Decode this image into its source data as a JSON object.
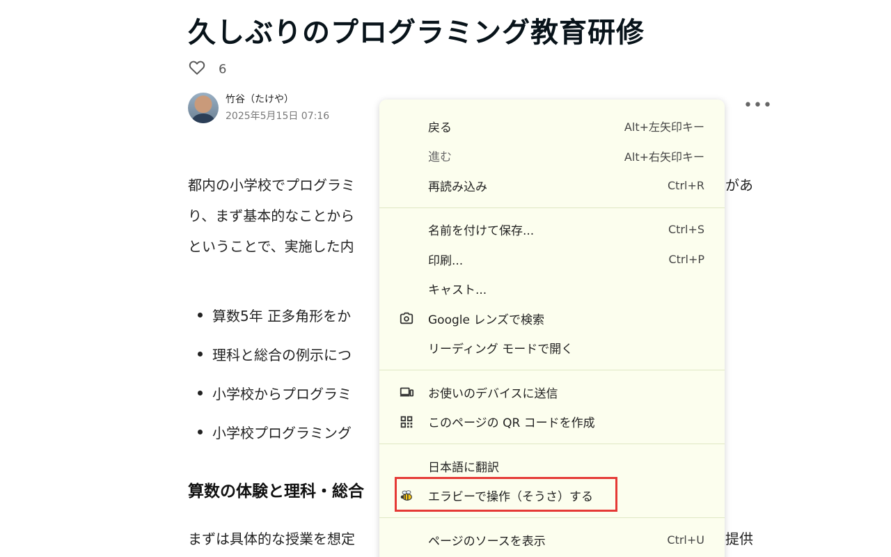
{
  "article": {
    "title": "久しぶりのプログラミング教育研修",
    "like_count": "6",
    "author_name": "竹谷（たけや）",
    "author_date": "2025年5月15日 07:16",
    "para_lines": [
      "都内の小学校でプログラミ",
      "り、まず基本的なことから",
      "ということで、実施した内"
    ],
    "para_right": "があ",
    "bullets": [
      "算数5年 正多角形をか",
      "理科と総合の例示につ",
      "小学校からプログラミ",
      "小学校プログラミング"
    ],
    "subhead": "算数の体験と理科・総合",
    "last_line": "まずは具体的な授業を想定",
    "last_right": "提供"
  },
  "context_menu": {
    "groups": [
      [
        {
          "label": "戻る",
          "shortcut": "Alt+左矢印キー",
          "icon": null,
          "disabled": false
        },
        {
          "label": "進む",
          "shortcut": "Alt+右矢印キー",
          "icon": null,
          "disabled": true
        },
        {
          "label": "再読み込み",
          "shortcut": "Ctrl+R",
          "icon": null,
          "disabled": false
        }
      ],
      [
        {
          "label": "名前を付けて保存...",
          "shortcut": "Ctrl+S",
          "icon": null,
          "disabled": false
        },
        {
          "label": "印刷...",
          "shortcut": "Ctrl+P",
          "icon": null,
          "disabled": false
        },
        {
          "label": "キャスト...",
          "shortcut": "",
          "icon": null,
          "disabled": false
        },
        {
          "label": "Google レンズで検索",
          "shortcut": "",
          "icon": "google-lens-icon",
          "disabled": false
        },
        {
          "label": "リーディング モードで開く",
          "shortcut": "",
          "icon": null,
          "disabled": false
        }
      ],
      [
        {
          "label": "お使いのデバイスに送信",
          "shortcut": "",
          "icon": "devices-icon",
          "disabled": false
        },
        {
          "label": "このページの QR コードを作成",
          "shortcut": "",
          "icon": "qr-code-icon",
          "disabled": false
        }
      ],
      [
        {
          "label": "日本語に翻訳",
          "shortcut": "",
          "icon": null,
          "disabled": false
        },
        {
          "label": "エラビーで操作（そうさ）する",
          "shortcut": "",
          "icon": "bee-icon",
          "disabled": false
        }
      ],
      [
        {
          "label": "ページのソースを表示",
          "shortcut": "Ctrl+U",
          "icon": null,
          "disabled": false
        }
      ]
    ]
  },
  "colors": {
    "menu_bg": "#fcfeee",
    "highlight_border": "#e53935"
  }
}
